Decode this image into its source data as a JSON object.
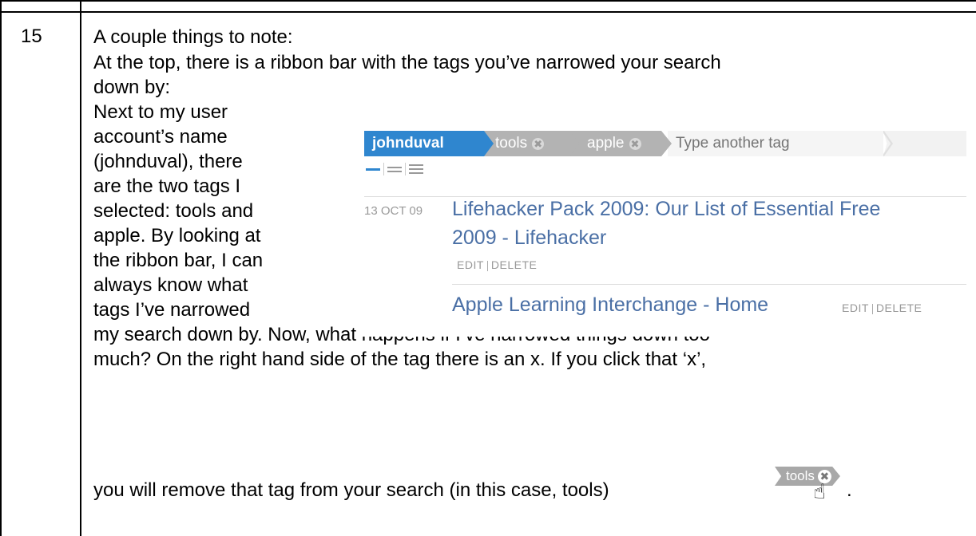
{
  "row_number": "15",
  "intro_line": "A couple things to note:",
  "para1_line1": "At the top, there is a ribbon bar with the tags you’ve narrowed your search",
  "para1_line2": "down by:",
  "side_lines": [
    "Next to my user",
    "account’s name",
    "(johnduval), there",
    "are the two tags I",
    "selected: tools and",
    "apple.  By looking at",
    "the ribbon bar, I can",
    "always know what",
    "tags I’ve narrowed"
  ],
  "para2_line1": "my search down by.  Now, what happens if I’ve narrowed things down too",
  "para2_line2": "much?  On the right hand side of the tag there is an x.  If you click that ‘x’,",
  "para2_line3": "you will remove that tag from your search (in this case, tools)",
  "trailing_period": ".",
  "screenshot": {
    "user": "johnduval",
    "tag1": "tools",
    "tag2": "apple",
    "remove_glyph": "✖",
    "input_placeholder": "Type another tag",
    "date": "13 OCT 09",
    "bookmark1_line1": "Lifehacker Pack 2009: Our List of Essential Free",
    "bookmark1_line2": "2009 - Lifehacker",
    "edit": "EDIT",
    "delete": "DELETE",
    "bookmark2": "Apple Learning Interchange - Home",
    "delete_truncated": "DELETE"
  },
  "tag_example": {
    "label": "tools",
    "remove_glyph": "✖",
    "pointer_glyph": "☝"
  },
  "colors": {
    "ribbon_user": "#2f86cf",
    "ribbon_tag": "#b3b3b3",
    "link": "#4a6fa5"
  }
}
